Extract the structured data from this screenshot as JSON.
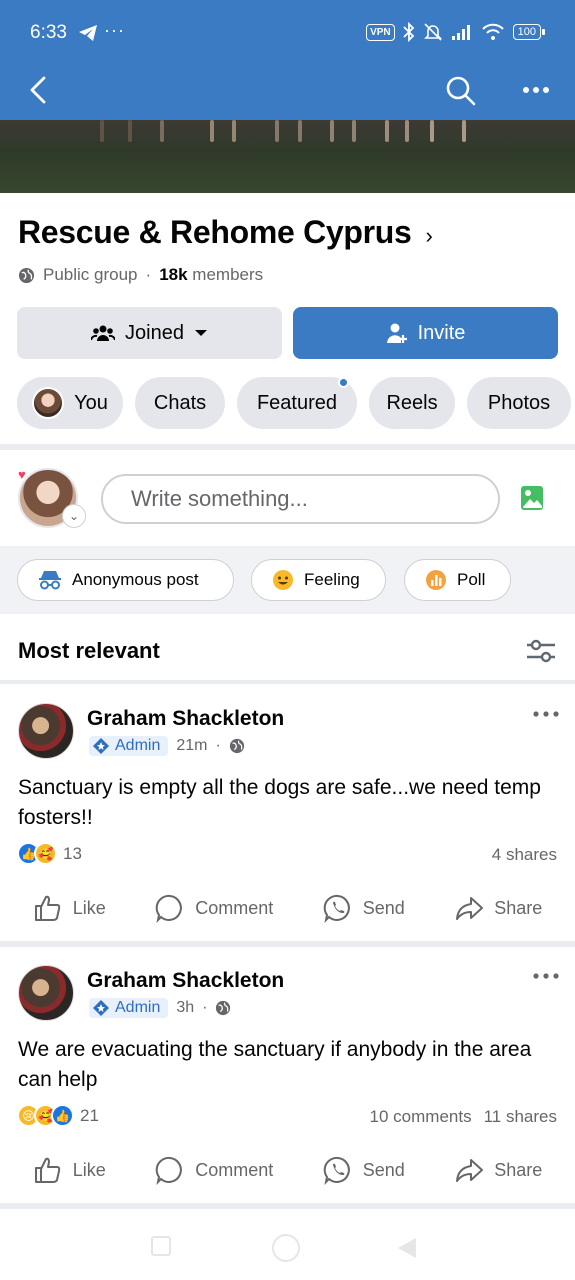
{
  "status_bar": {
    "time": "6:33",
    "dots": "···",
    "vpn": "VPN",
    "battery": "100"
  },
  "group": {
    "name": "Rescue & Rehome Cyprus",
    "chevron": "›",
    "privacy": "Public group",
    "members_count": "18k",
    "members_label": "members",
    "joined_label": "Joined",
    "invite_label": "Invite"
  },
  "tabs": [
    {
      "label": "You"
    },
    {
      "label": "Chats"
    },
    {
      "label": "Featured"
    },
    {
      "label": "Reels"
    },
    {
      "label": "Photos"
    }
  ],
  "composer": {
    "placeholder": "Write something..."
  },
  "quick_actions": [
    {
      "label": "Anonymous post",
      "icon": "incognito-icon"
    },
    {
      "label": "Feeling",
      "icon": "smiley-icon"
    },
    {
      "label": "Poll",
      "icon": "poll-icon"
    }
  ],
  "feed": {
    "sort_label": "Most relevant"
  },
  "posts": [
    {
      "author": "Graham Shackleton",
      "role": "Admin",
      "time": "21m",
      "text": "Sanctuary is empty all the dogs are safe...we need temp fosters!!",
      "reactions": [
        "like",
        "care"
      ],
      "reaction_count": "13",
      "comments": "",
      "shares": "4 shares"
    },
    {
      "author": "Graham Shackleton",
      "role": "Admin",
      "time": "3h",
      "text": "We are evacuating the sanctuary if anybody in the area can help",
      "reactions": [
        "sad",
        "care",
        "like"
      ],
      "reaction_count": "21",
      "comments": "10 comments",
      "shares": "11 shares"
    }
  ],
  "actions": {
    "like": "Like",
    "comment": "Comment",
    "send": "Send",
    "share": "Share"
  },
  "colors": {
    "brand_blue": "#3a7bc4",
    "chip_gray": "#e4e6eb",
    "meta_gray": "#65676b"
  }
}
